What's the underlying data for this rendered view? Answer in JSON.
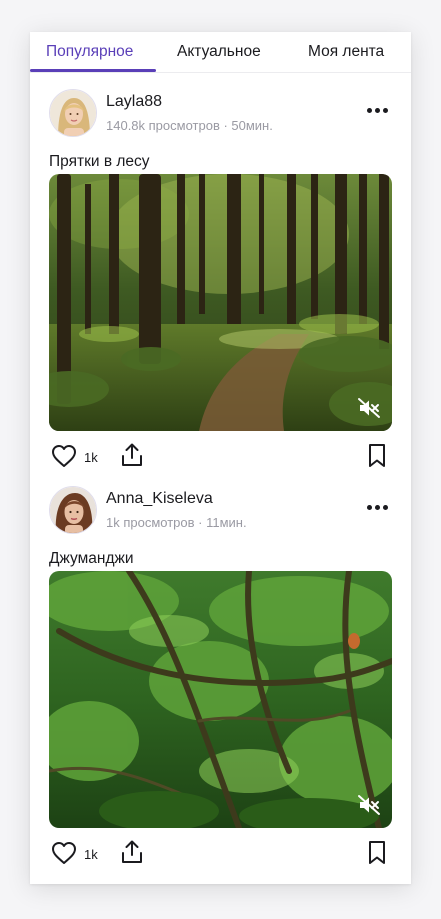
{
  "tabs": [
    {
      "label": "Популярное",
      "active": true
    },
    {
      "label": "Актуальное",
      "active": false
    },
    {
      "label": "Моя лента",
      "active": false
    }
  ],
  "accent_color": "#5a3fb8",
  "posts": [
    {
      "username": "Layla88",
      "meta": "140.8k просмотров · 50мин.",
      "caption": "Прятки в лесу",
      "likes": "1k",
      "media_icon": "mute-icon"
    },
    {
      "username": "Anna_Kiseleva",
      "meta": "1k просмотров · 11мин.",
      "caption": "Джуманджи",
      "likes": "1k",
      "media_icon": "mute-icon"
    }
  ]
}
